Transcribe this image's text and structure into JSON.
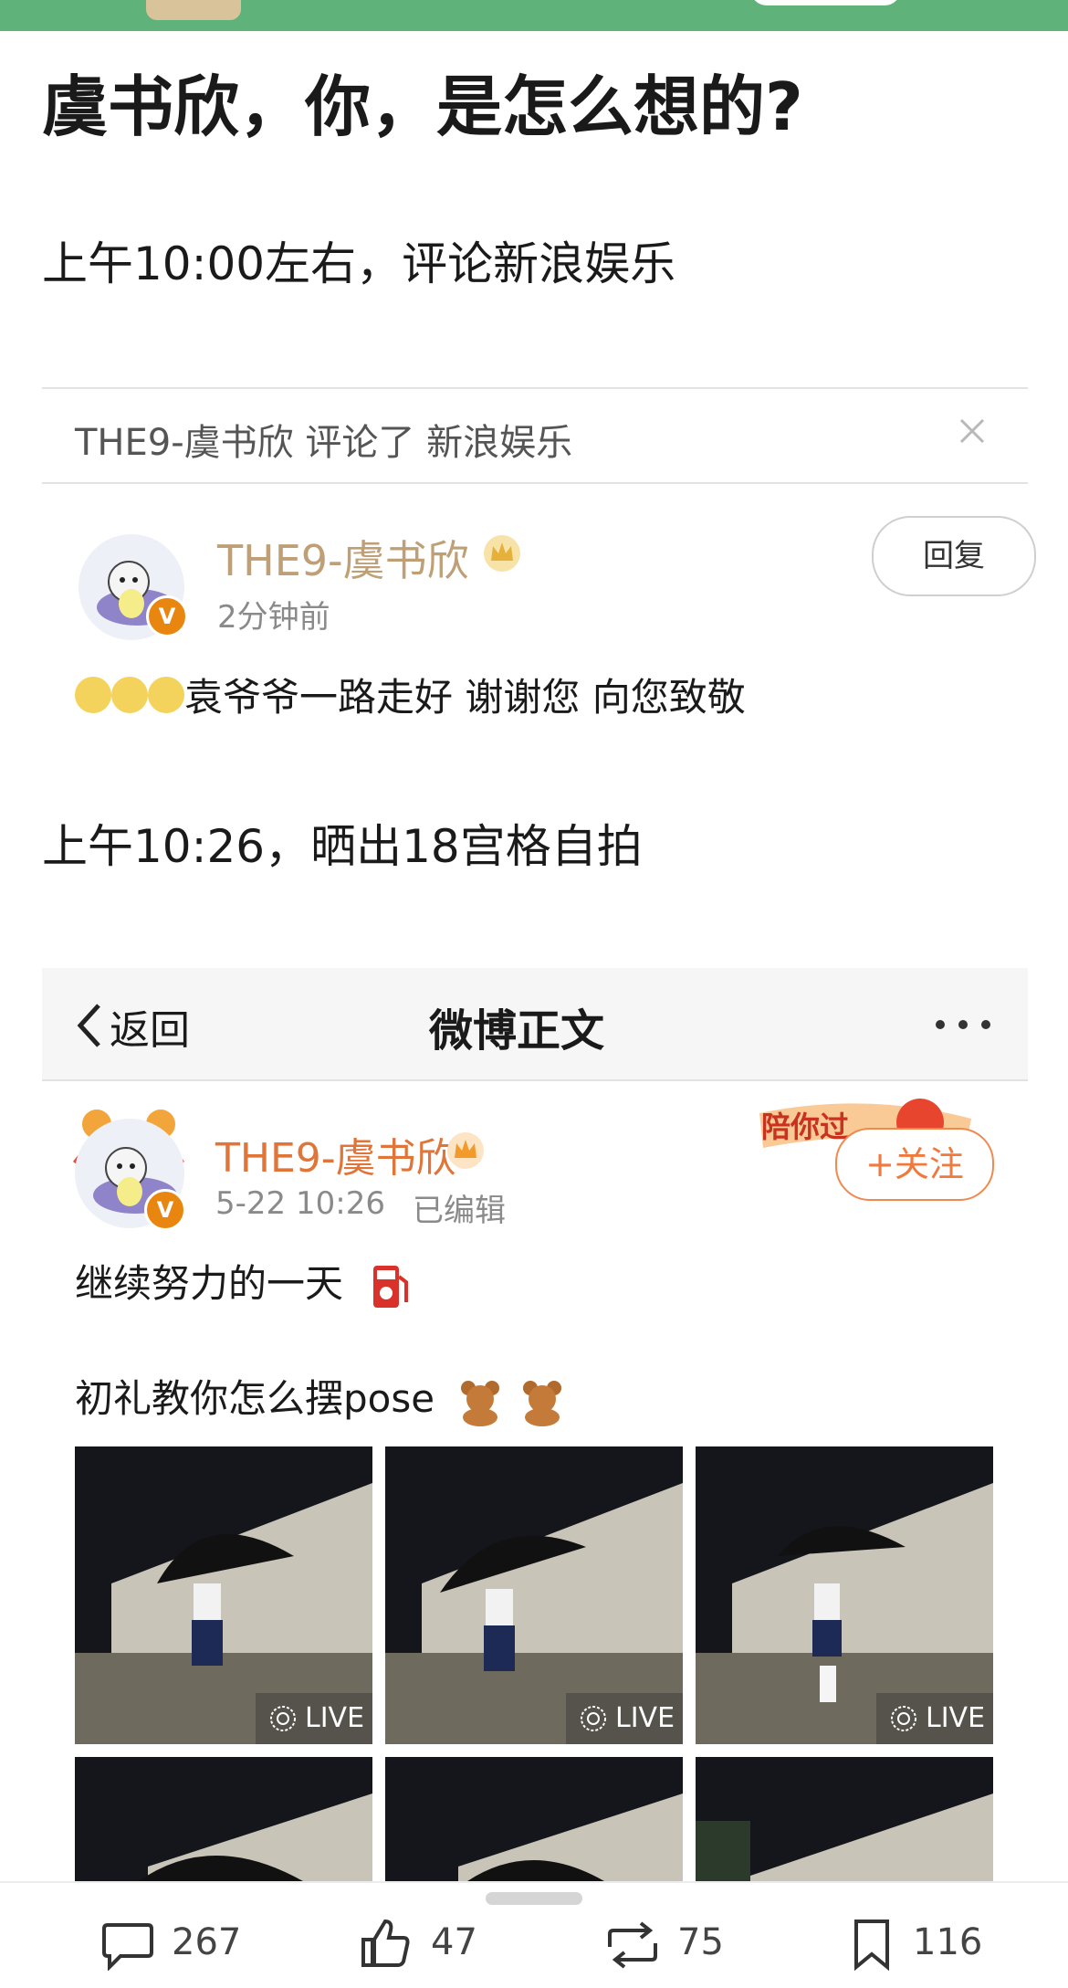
{
  "article": {
    "title": "虞书欣，你，是怎么想的?",
    "para1": "上午10:00左右，评论新浪娱乐",
    "para2": "上午10:26，晒出18宫格自拍"
  },
  "screenshot1": {
    "header": "THE9-虞书欣 评论了 新浪娱乐",
    "username": "THE9-虞书欣",
    "time": "2分钟前",
    "reply_label": "回复",
    "comment": "袁爷爷一路走好 谢谢您 向您致敬",
    "verified": "V"
  },
  "screenshot2": {
    "nav": {
      "back": "返回",
      "title": "微博正文"
    },
    "username": "THE9-虞书欣",
    "date": "5-22 10:26",
    "edited": "已编辑",
    "follow_label": "+关注",
    "banner_text": "陪你过",
    "verified": "V",
    "line1": "继续努力的一天",
    "line2": "初礼教你怎么摆pose",
    "live_label": "LIVE"
  },
  "actions": {
    "comments": "267",
    "likes": "47",
    "reposts": "75",
    "saves": "116"
  },
  "colors": {
    "topbar": "#5fb37a",
    "accent_orange": "#f07a3e",
    "name_tan": "#bf9f75"
  }
}
